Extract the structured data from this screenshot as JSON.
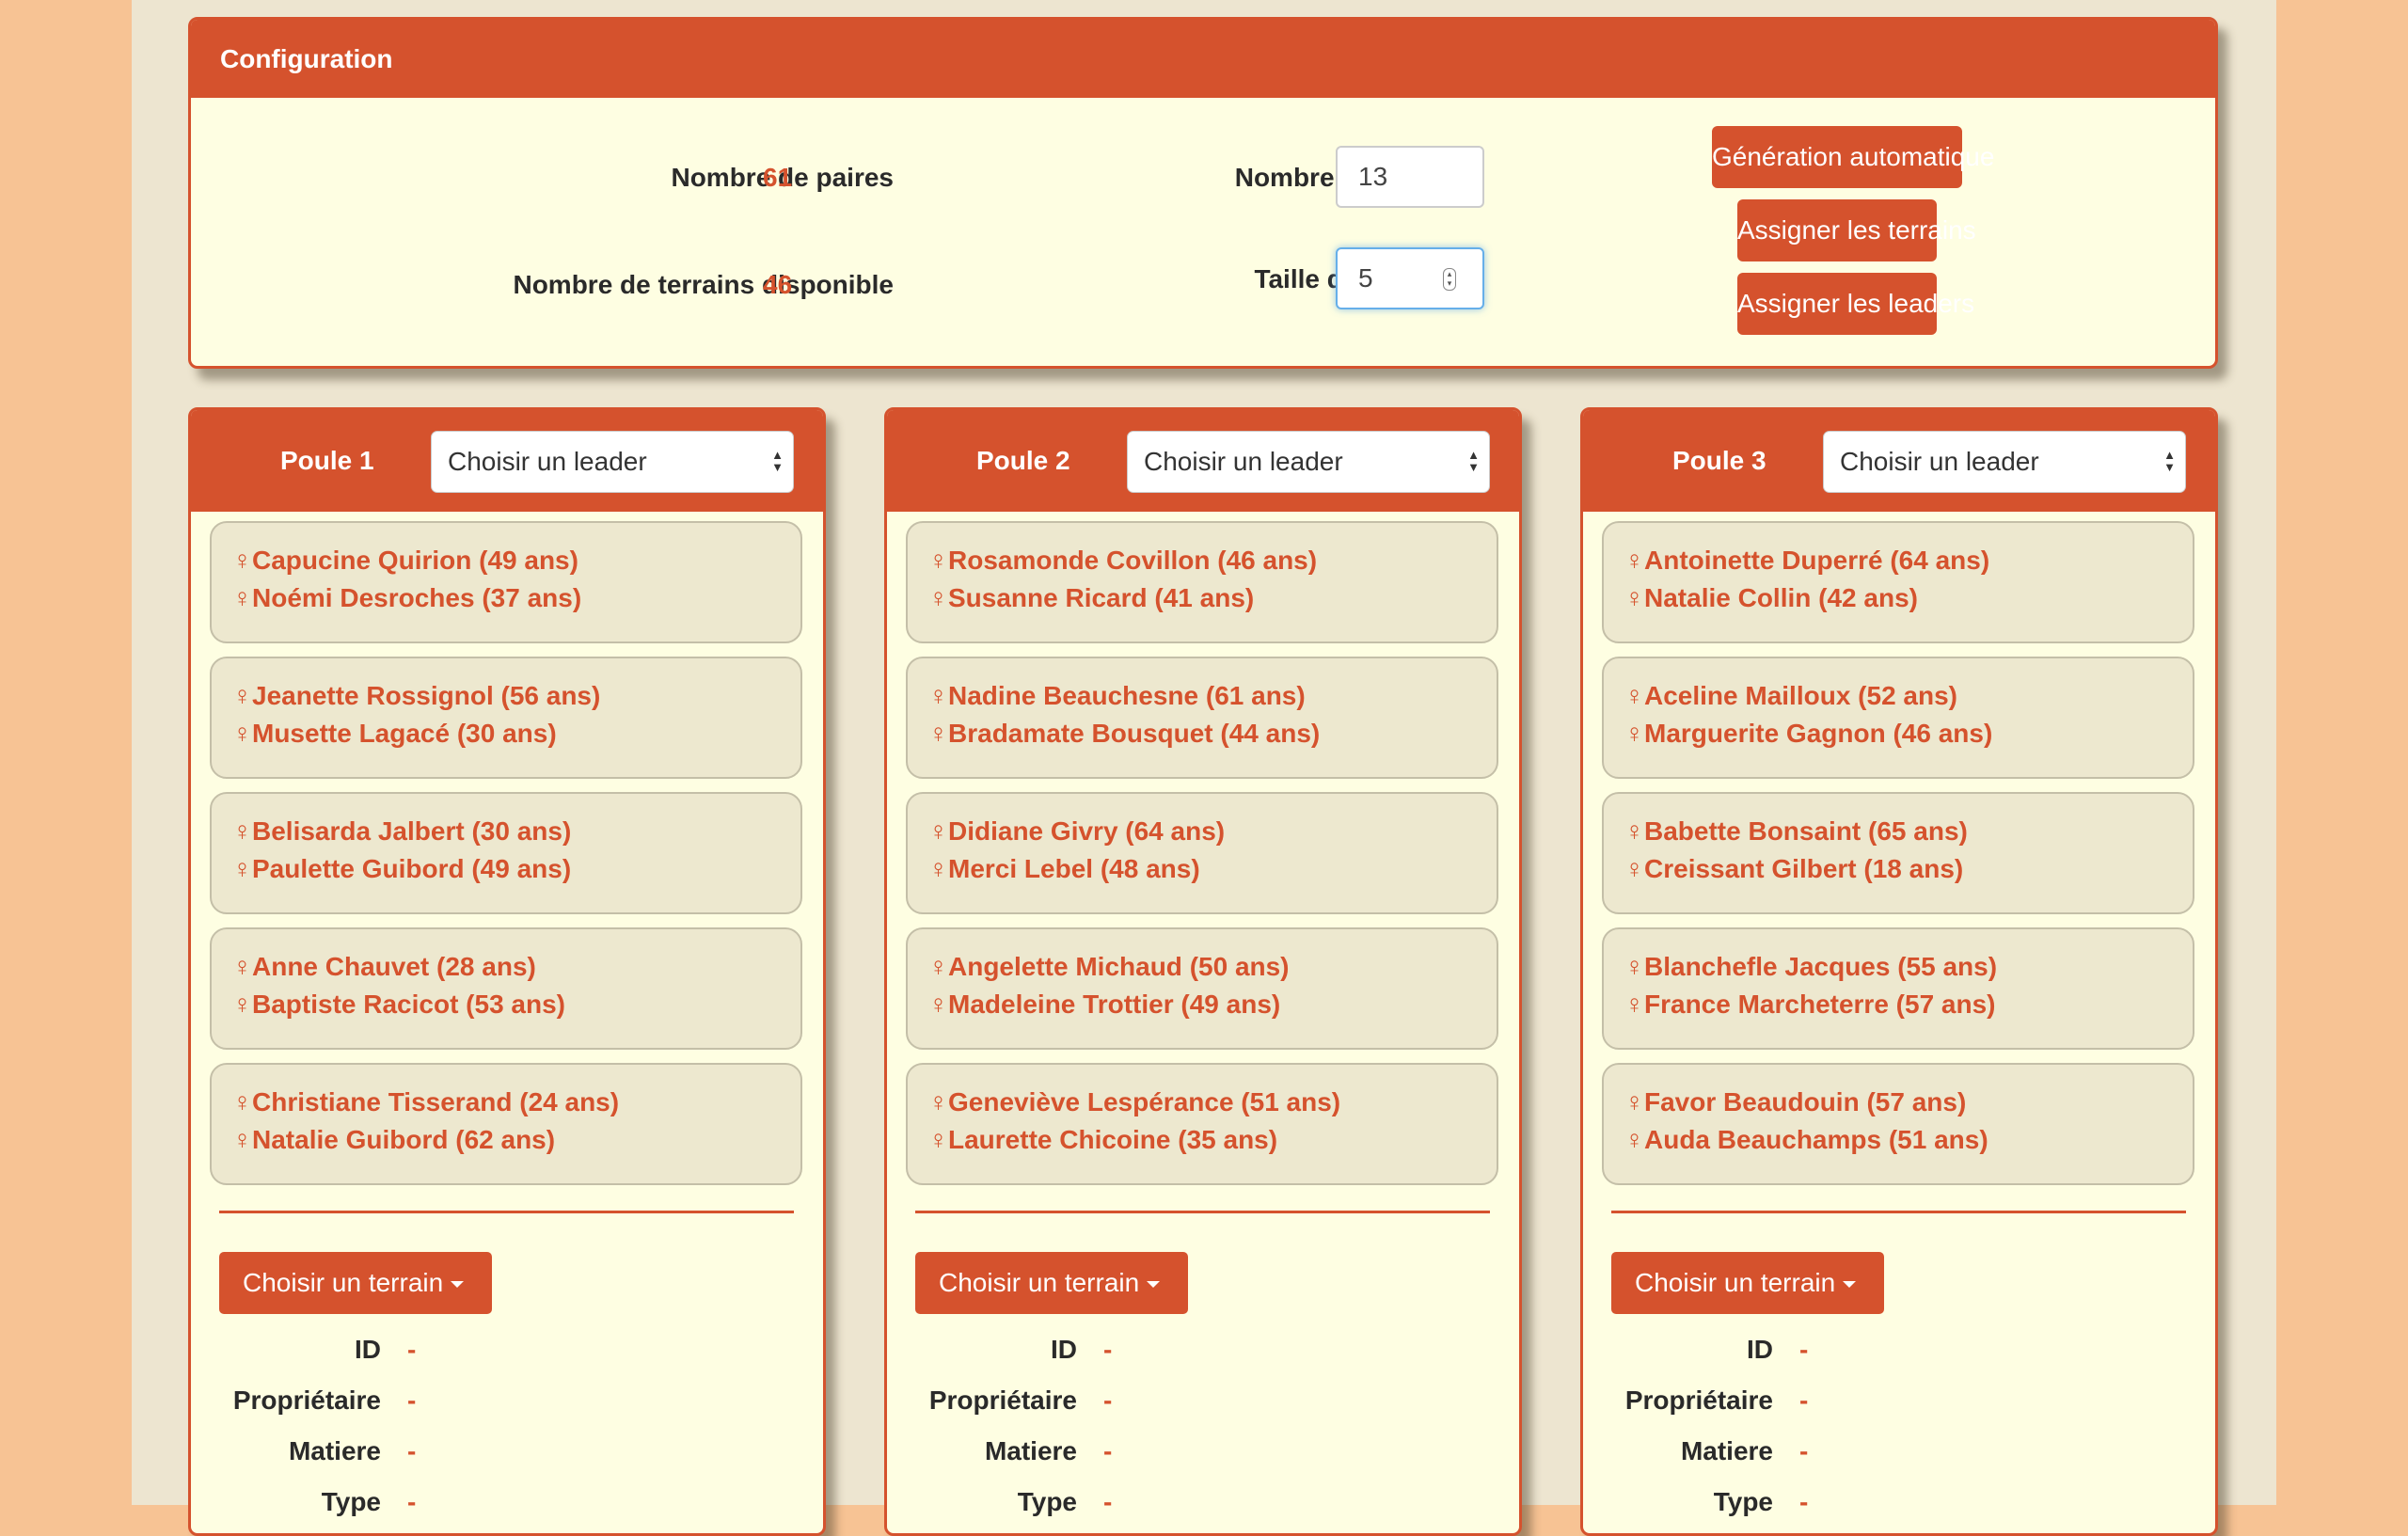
{
  "config": {
    "title": "Configuration",
    "nb_paires_label": "Nombre de paires",
    "nb_paires_value": "61",
    "nb_terrains_label": "Nombre de terrains disponible",
    "nb_terrains_value": "46",
    "nb_poules_label": "Nombre de poules",
    "nb_poules_value": "13",
    "taille_poules_label": "Taille des poules",
    "taille_poules_value": "5",
    "btn_generation": "Génération automatique",
    "btn_terrains": "Assigner les terrains",
    "btn_leaders": "Assigner les leaders"
  },
  "poules": [
    {
      "title": "Poule 1",
      "leader_select": "Choisir un leader",
      "pairs": [
        [
          "Capucine Quirion (49 ans)",
          "Noémi Desroches (37 ans)"
        ],
        [
          "Jeanette Rossignol (56 ans)",
          "Musette Lagacé (30 ans)"
        ],
        [
          "Belisarda Jalbert (30 ans)",
          "Paulette Guibord (49 ans)"
        ],
        [
          "Anne Chauvet (28 ans)",
          "Baptiste Racicot (53 ans)"
        ],
        [
          "Christiane Tisserand (24 ans)",
          "Natalie Guibord (62 ans)"
        ]
      ],
      "terrain_button": "Choisir un terrain",
      "fields": [
        {
          "label": "ID",
          "value": "-"
        },
        {
          "label": "Propriétaire",
          "value": "-"
        },
        {
          "label": "Matiere",
          "value": "-"
        },
        {
          "label": "Type",
          "value": "-"
        }
      ]
    },
    {
      "title": "Poule 2",
      "leader_select": "Choisir un leader",
      "pairs": [
        [
          "Rosamonde Covillon (46 ans)",
          "Susanne Ricard (41 ans)"
        ],
        [
          "Nadine Beauchesne (61 ans)",
          "Bradamate Bousquet (44 ans)"
        ],
        [
          "Didiane Givry (64 ans)",
          "Merci Lebel (48 ans)"
        ],
        [
          "Angelette Michaud (50 ans)",
          "Madeleine Trottier (49 ans)"
        ],
        [
          "Geneviève Lespérance (51 ans)",
          "Laurette Chicoine (35 ans)"
        ]
      ],
      "terrain_button": "Choisir un terrain",
      "fields": [
        {
          "label": "ID",
          "value": "-"
        },
        {
          "label": "Propriétaire",
          "value": "-"
        },
        {
          "label": "Matiere",
          "value": "-"
        },
        {
          "label": "Type",
          "value": "-"
        }
      ]
    },
    {
      "title": "Poule 3",
      "leader_select": "Choisir un leader",
      "pairs": [
        [
          "Antoinette Duperré (64 ans)",
          "Natalie Collin (42 ans)"
        ],
        [
          "Aceline Mailloux (52 ans)",
          "Marguerite Gagnon (46 ans)"
        ],
        [
          "Babette Bonsaint (65 ans)",
          "Creissant Gilbert (18 ans)"
        ],
        [
          "Blanchefle Jacques (55 ans)",
          "France Marcheterre (57 ans)"
        ],
        [
          "Favor Beaudouin (57 ans)",
          "Auda Beauchamps (51 ans)"
        ]
      ],
      "terrain_button": "Choisir un terrain",
      "fields": [
        {
          "label": "ID",
          "value": "-"
        },
        {
          "label": "Propriétaire",
          "value": "-"
        },
        {
          "label": "Matiere",
          "value": "-"
        },
        {
          "label": "Type",
          "value": "-"
        }
      ]
    }
  ]
}
